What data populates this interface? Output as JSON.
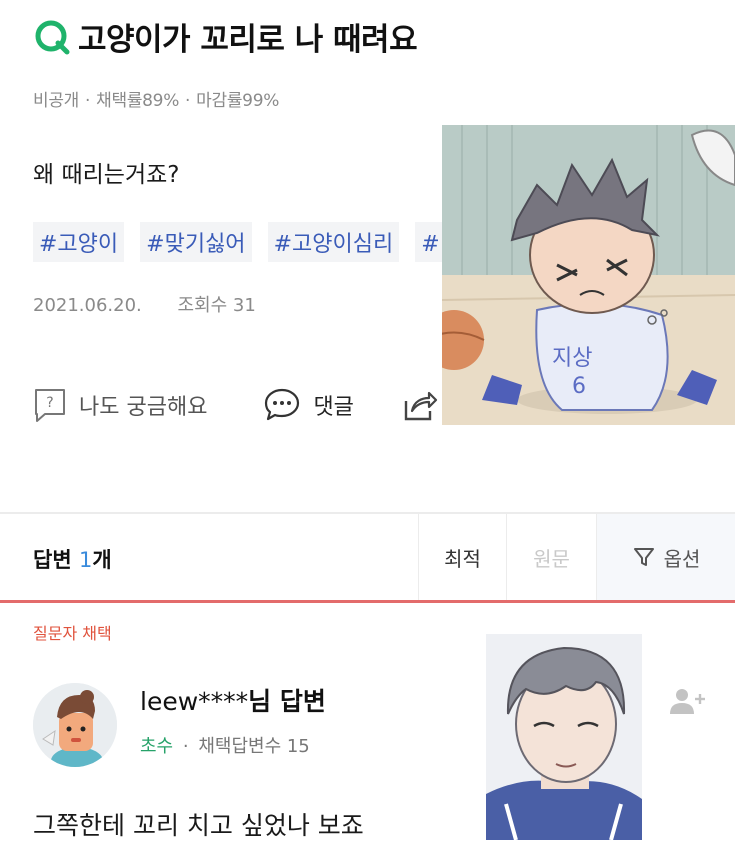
{
  "question": {
    "title": "고양이가 꼬리로 나 때려요",
    "meta": [
      "비공개",
      "채택률89%",
      "마감률99%"
    ],
    "body": "왜 때리는거죠?",
    "tags": [
      "#고양이",
      "#맞기싫어",
      "#고양이심리",
      "#ㅣ"
    ],
    "date": "2021.06.20.",
    "views": "조회수 31",
    "actions": {
      "curious": "나도 궁금해요",
      "comment": "댓글"
    }
  },
  "answers_bar": {
    "label": "답변",
    "count": "1",
    "unit": "개",
    "sort_best": "최적",
    "sort_original": "원문",
    "options": "옵션"
  },
  "answer": {
    "badge": "질문자 채택",
    "user": "leew****",
    "suffix": "님 답변",
    "rank": "초수",
    "adopted": "채택답변수 15",
    "text": "그쪽한테 꼬리 치고 싶었나 보죠"
  },
  "colors": {
    "accent_green": "#26a269",
    "tag_blue": "#3a5bb8",
    "highlight_red": "#e36b6b"
  }
}
